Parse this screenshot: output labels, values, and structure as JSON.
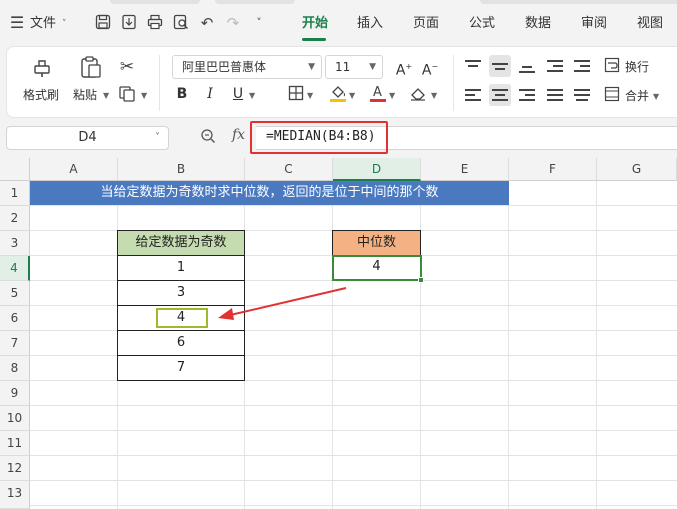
{
  "menubar": {
    "file_label": "文件",
    "tabs": [
      "开始",
      "插入",
      "页面",
      "公式",
      "数据",
      "审阅",
      "视图"
    ],
    "active_tab": "开始"
  },
  "ribbon": {
    "format_painter": "格式刷",
    "paste": "粘贴",
    "font_name": "阿里巴巴普惠体",
    "font_size": "11",
    "wrap_text": "换行",
    "merge": "合并"
  },
  "formula_bar": {
    "name_box": "D4",
    "fx": "fx",
    "formula": "=MEDIAN(B4:B8)"
  },
  "sheet": {
    "columns": [
      "A",
      "B",
      "C",
      "D",
      "E",
      "F",
      "G"
    ],
    "rows": [
      "1",
      "2",
      "3",
      "4",
      "5",
      "6",
      "7",
      "8",
      "9",
      "10",
      "11",
      "12",
      "13"
    ],
    "selected_column": "D",
    "selected_row": "4",
    "banner_text": "当给定数据为奇数时求中位数，返回的是位于中间的那个数",
    "data_header": "给定数据为奇数",
    "data_values": [
      "1",
      "3",
      "4",
      "6",
      "7"
    ],
    "median_header": "中位数",
    "median_value": "4"
  },
  "colors": {
    "accent": "#1a7f4b",
    "banner": "#4a79c0",
    "data_header_bg": "#c5dcb0",
    "median_header_bg": "#f4b183",
    "formula_highlight": "#e03232",
    "arrow": "#e03232"
  }
}
